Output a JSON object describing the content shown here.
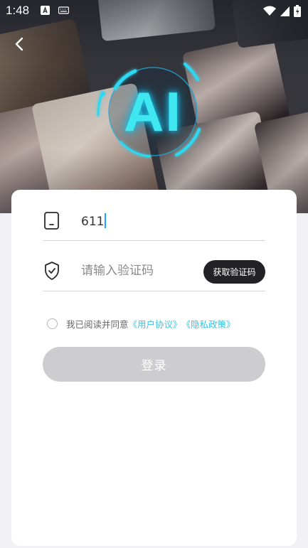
{
  "status_bar": {
    "time": "1:48"
  },
  "logo": {
    "text": "AI"
  },
  "form": {
    "phone_value": "611",
    "code_placeholder": "请输入验证码",
    "get_code_label": "获取验证码",
    "agreement_prefix": "我已阅读并同意",
    "user_agreement": "《用户协议》",
    "privacy_policy": "《隐私政策》",
    "login_label": "登录"
  },
  "colors": {
    "accent_cyan": "#39c6e0",
    "button_dark": "#222226",
    "login_disabled": "#cdcdd0"
  }
}
